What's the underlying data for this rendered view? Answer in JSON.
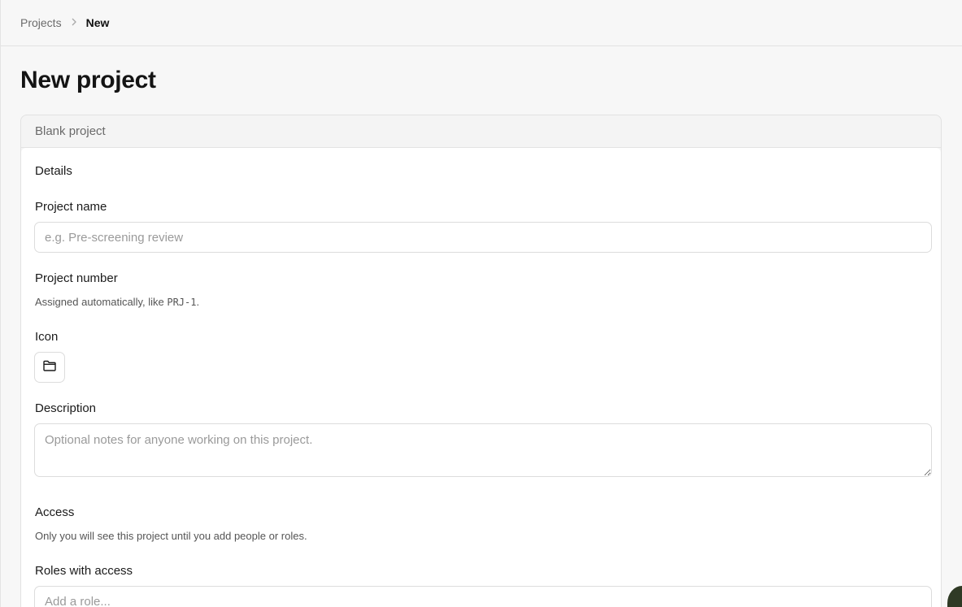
{
  "breadcrumb": {
    "items": [
      "Projects"
    ],
    "current": "New"
  },
  "page": {
    "title": "New project"
  },
  "template_tab": {
    "label": "Blank project"
  },
  "form": {
    "details_heading": "Details",
    "project_name": {
      "label": "Project name",
      "placeholder": "e.g. Pre-screening review",
      "value": ""
    },
    "project_number": {
      "label": "Project number",
      "hint_prefix": "Assigned automatically, like ",
      "hint_code": "PRJ-1",
      "hint_suffix": "."
    },
    "icon": {
      "label": "Icon",
      "selected_icon": "folder-icon"
    },
    "description": {
      "label": "Description",
      "placeholder": "Optional notes for anyone working on this project.",
      "value": ""
    },
    "access_heading": "Access",
    "access_hint": "Only you will see this project until you add people or roles.",
    "roles": {
      "label": "Roles with access",
      "placeholder": "Add a role..."
    }
  },
  "colors": {
    "page_background": "#f7f7f7",
    "card_background": "#ffffff",
    "border": "#dcdcdc",
    "muted_text": "#6b6b6b"
  }
}
